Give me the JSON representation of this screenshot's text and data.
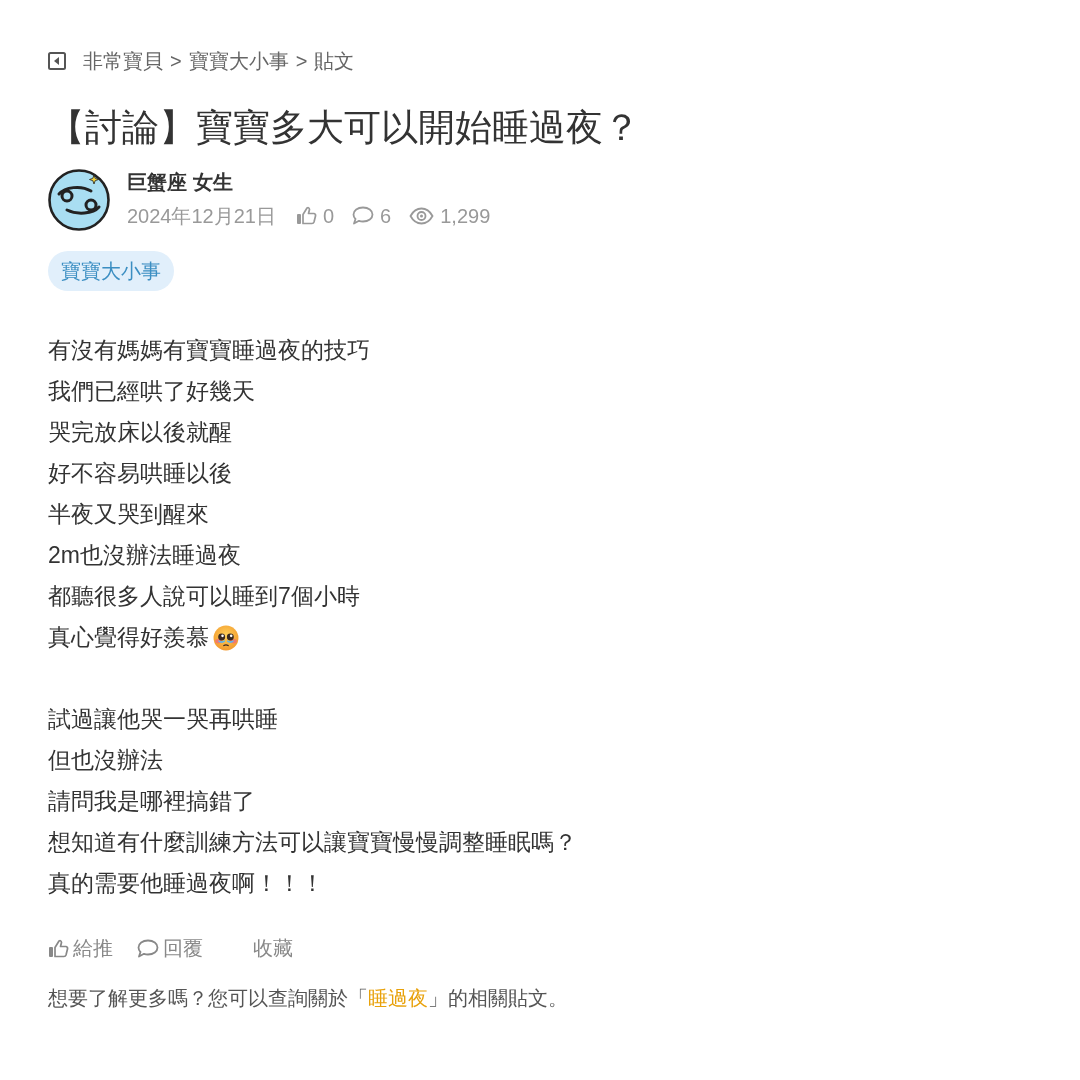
{
  "breadcrumb": {
    "items": [
      "非常寶貝",
      "寶寶大小事",
      "貼文"
    ],
    "separators": [
      ">",
      ">"
    ]
  },
  "post": {
    "title": "【討論】寶寶多大可以開始睡過夜？",
    "author": {
      "name": "巨蟹座 女生"
    },
    "meta": {
      "date": "2024年12月21日",
      "likes": "0",
      "comments": "6",
      "views": "1,299"
    },
    "tag": "寶寶大小事",
    "body": [
      [
        {
          "text": "有沒有媽媽有寶寶睡過夜的技巧"
        },
        {
          "text": "我們已經哄了好幾天"
        },
        {
          "text": "哭完放床以後就醒"
        },
        {
          "text": "好不容易哄睡以後"
        },
        {
          "text": "半夜又哭到醒來"
        },
        {
          "text": "2m也沒辦法睡過夜"
        },
        {
          "text": "都聽很多人說可以睡到7個小時"
        },
        {
          "text": "真心覺得好羨慕",
          "emoji": true
        }
      ],
      [
        {
          "text": "試過讓他哭一哭再哄睡"
        },
        {
          "text": "但也沒辦法"
        },
        {
          "text": "請問我是哪裡搞錯了"
        },
        {
          "text": "想知道有什麼訓練方法可以讓寶寶慢慢調整睡眠嗎？"
        },
        {
          "text": "真的需要他睡過夜啊！！！"
        }
      ]
    ],
    "actions": [
      {
        "kind": "like",
        "label": "給推"
      },
      {
        "kind": "reply",
        "label": "回覆"
      },
      {
        "kind": "save",
        "label": "收藏"
      }
    ]
  },
  "related": {
    "before": "想要了解更多嗎？您可以查詢關於「",
    "link": "睡過夜",
    "after": "」的相關貼文。"
  }
}
